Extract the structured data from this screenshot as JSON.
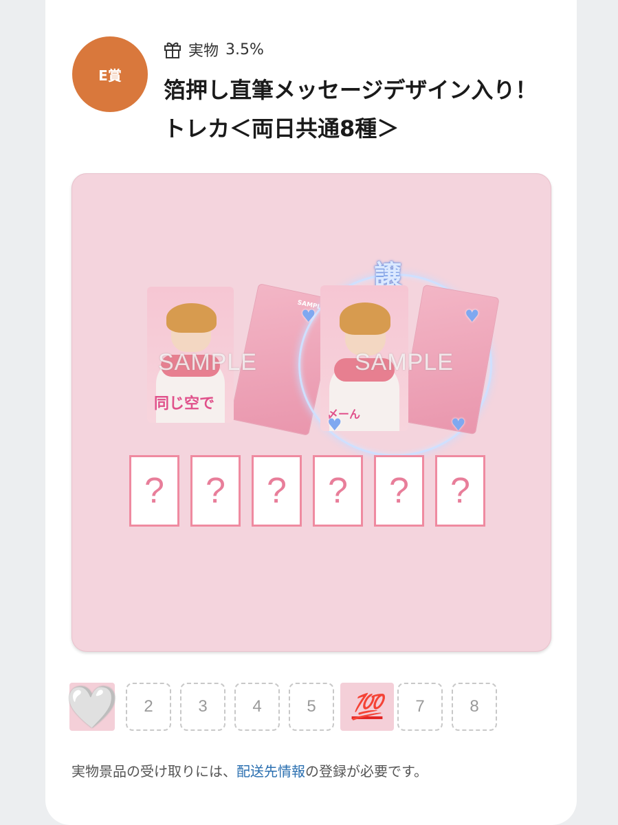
{
  "prize": {
    "badge": "E賞",
    "type_label": "実物",
    "probability": "3.5%",
    "icon": "gift-icon",
    "title": "箔押し直筆メッセージデザイン入り！トレカ＜両日共通8種＞"
  },
  "image": {
    "watermark": "SAMPLE",
    "card_back_logo": "SAMPLE",
    "signature_left": "同じ空で",
    "signature_right": "〆ーん",
    "circle_name": "譲",
    "mystery_slots": [
      "?",
      "?",
      "?",
      "?",
      "?",
      "?"
    ],
    "colors": {
      "panel": "#f4d4dd",
      "accent_pink": "#ef8aa0",
      "glow_blue": "#cfe0ff"
    }
  },
  "variants": {
    "items": [
      {
        "label": "🤍",
        "selected": true
      },
      {
        "label": "2"
      },
      {
        "label": "3"
      },
      {
        "label": "4"
      },
      {
        "label": "5"
      },
      {
        "label": "💯"
      },
      {
        "label": "7"
      },
      {
        "label": "8"
      }
    ]
  },
  "notice": {
    "before": "実物景品の受け取りには、",
    "link": "配送先情報",
    "after": "の登録が必要です。"
  },
  "colors": {
    "badge": "#d9783c",
    "link": "#2a6fb0"
  }
}
